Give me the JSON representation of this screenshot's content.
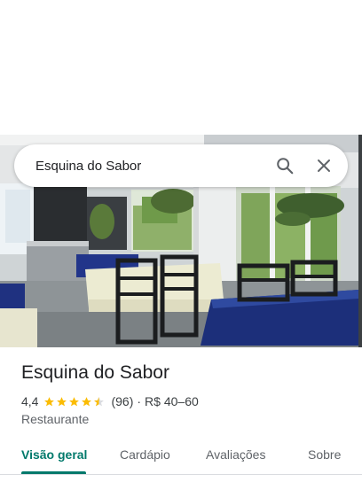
{
  "search": {
    "query": "Esquina do Sabor"
  },
  "place": {
    "name": "Esquina do Sabor",
    "rating": "4,4",
    "rating_value": 4.4,
    "reviews": "(96)",
    "separator": "·",
    "price": "R$ 40–60",
    "category": "Restaurante"
  },
  "tabs": [
    {
      "label": "Visão geral",
      "active": true
    },
    {
      "label": "Cardápio",
      "active": false
    },
    {
      "label": "Avaliações",
      "active": false
    },
    {
      "label": "Sobre",
      "active": false
    }
  ],
  "colors": {
    "star": "#fbbc04",
    "accent": "#00796b",
    "table_cloth_blue": "#1c2f7a",
    "table_cloth_cream": "#ecebd2"
  },
  "icons": {
    "search": "search-icon",
    "close": "close-icon",
    "star": "star-icon"
  }
}
